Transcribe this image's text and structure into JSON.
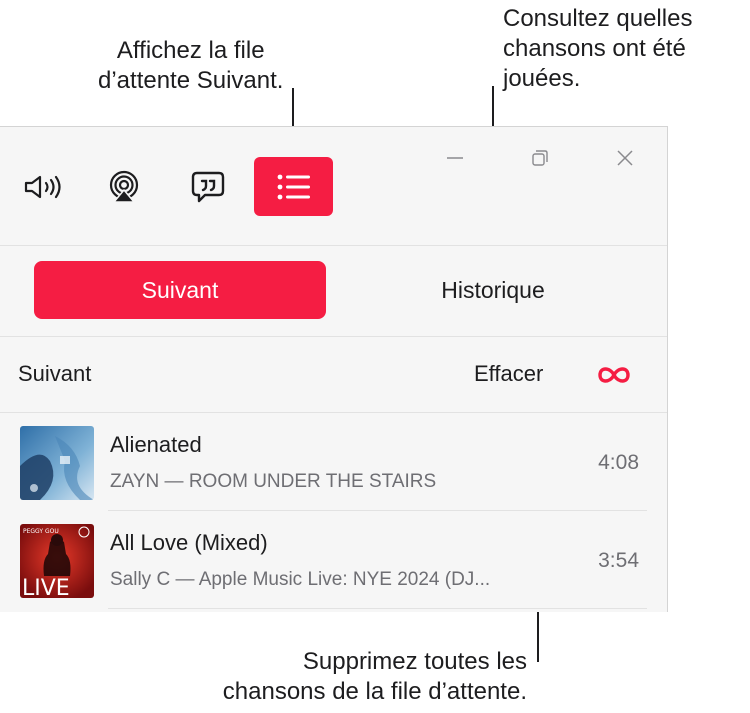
{
  "callouts": {
    "queue": [
      "Affichez la file",
      "d’attente Suivant."
    ],
    "history": [
      "Consultez quelles",
      "chansons ont été",
      "jouées."
    ],
    "clear": [
      "Supprimez toutes les",
      "chansons de la file d’attente."
    ]
  },
  "toolbar": {
    "volume_icon": "speaker-wave-icon",
    "airplay_icon": "airplay-icon",
    "lyrics_icon": "lyrics-bubble-icon",
    "queue_icon": "list-icon",
    "accent": "#f51d43"
  },
  "tabs": {
    "active": "Suivant",
    "inactive": "Historique"
  },
  "queue": {
    "title": "Suivant",
    "clear_label": "Effacer",
    "repeat_icon": "infinity-icon",
    "tracks": [
      {
        "title": "Alienated",
        "subtitle": "ZAYN — ROOM UNDER THE STAIRS",
        "duration": "4:08"
      },
      {
        "title": "All Love (Mixed)",
        "subtitle": "Sally C — Apple Music Live: NYE 2024 (DJ...",
        "duration": "3:54",
        "art_text": "LIVE",
        "art_small": "PEGGY GOU"
      }
    ]
  }
}
